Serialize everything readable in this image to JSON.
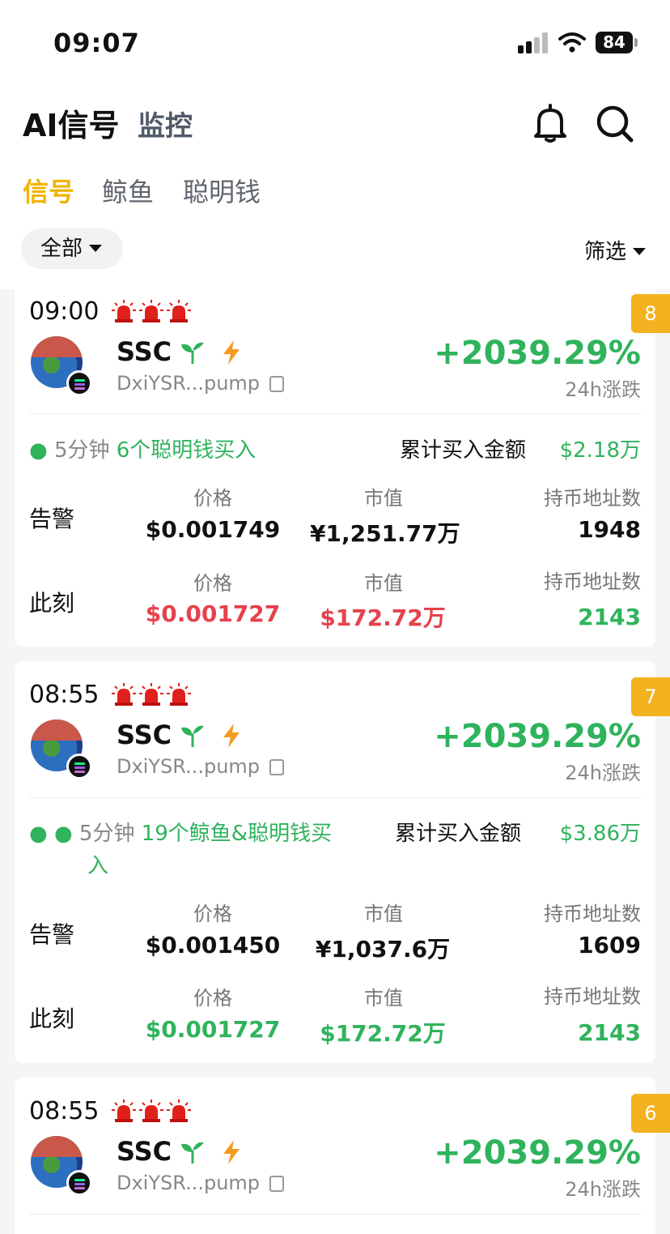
{
  "status_bar": {
    "time": "09:07",
    "battery": "84"
  },
  "header": {
    "title": "AI信号",
    "secondary_tab": "监控"
  },
  "tabs": [
    {
      "label": "信号",
      "active": true
    },
    {
      "label": "鲸鱼",
      "active": false
    },
    {
      "label": "聪明钱",
      "active": false
    }
  ],
  "filters": {
    "scope": "全部",
    "screen": "筛选"
  },
  "labels": {
    "change_24h": "24h涨跌",
    "cumulative": "累计买入金额",
    "alert": "告警",
    "now": "此刻",
    "price": "价格",
    "mcap": "市值",
    "holders": "持币地址数"
  },
  "cards": [
    {
      "badge": "8",
      "time": "09:00",
      "symbol": "SSC",
      "address": "DxiYSR...pump",
      "change": "+2039.29%",
      "buy_period": "5分钟",
      "buy_text": "6个聪明钱买入",
      "cumulative_amount": "$2.18万",
      "alert": {
        "price": "$0.001749",
        "mcap": "¥1,251.77万",
        "holders": "1948"
      },
      "now": {
        "price": "$0.001727",
        "mcap": "$172.72万",
        "holders": "2143"
      }
    },
    {
      "badge": "7",
      "time": "08:55",
      "symbol": "SSC",
      "address": "DxiYSR...pump",
      "change": "+2039.29%",
      "buy_period": "5分钟",
      "buy_text_1": "19个鲸鱼&聪明钱买",
      "buy_text_2": "入",
      "cumulative_amount": "$3.86万",
      "alert": {
        "price": "$0.001450",
        "mcap": "¥1,037.6万",
        "holders": "1609"
      },
      "now": {
        "price": "$0.001727",
        "mcap": "$172.72万",
        "holders": "2143"
      }
    },
    {
      "badge": "6",
      "time": "08:55",
      "symbol": "SSC",
      "address": "DxiYSR...pump",
      "change": "+2039.29%"
    }
  ],
  "colors": {
    "accent": "#f0b400",
    "up": "#2fb35c",
    "down": "#e5424d",
    "badge": "#f3b21f"
  }
}
